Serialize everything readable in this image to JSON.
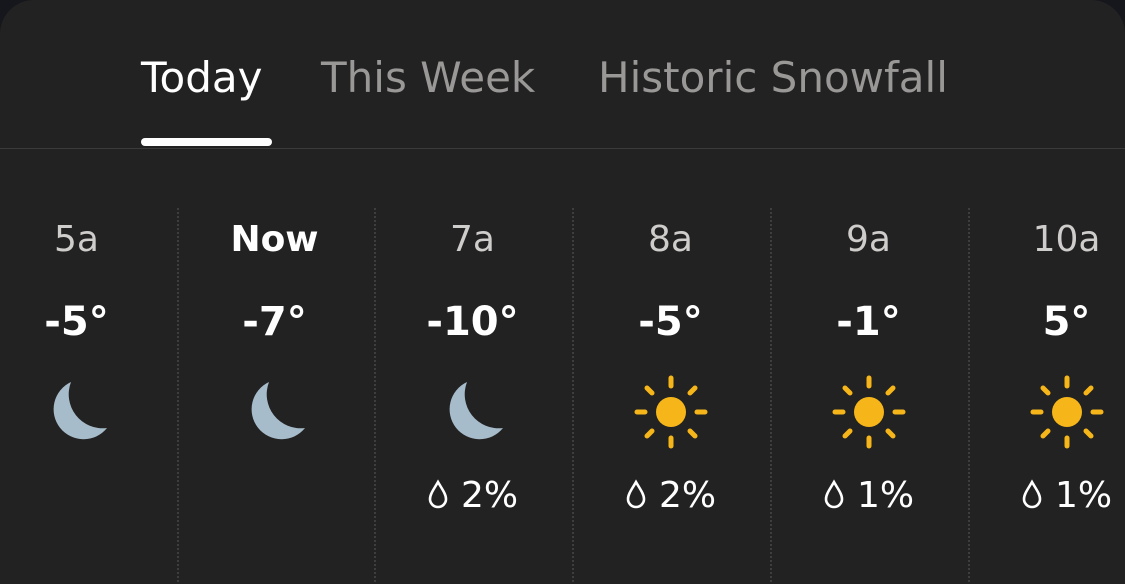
{
  "tabs": [
    {
      "label": "Today",
      "active": true
    },
    {
      "label": "This Week",
      "active": false
    },
    {
      "label": "Historic Snowfall",
      "active": false
    }
  ],
  "hours": [
    {
      "time": "5a",
      "temp": "-5°",
      "icon": "moon-icon",
      "precip": ""
    },
    {
      "time": "Now",
      "temp": "-7°",
      "icon": "moon-icon",
      "precip": ""
    },
    {
      "time": "7a",
      "temp": "-10°",
      "icon": "moon-icon",
      "precip": "2%"
    },
    {
      "time": "8a",
      "temp": "-5°",
      "icon": "sun-icon",
      "precip": "2%"
    },
    {
      "time": "9a",
      "temp": "-1°",
      "icon": "sun-icon",
      "precip": "1%"
    },
    {
      "time": "10a",
      "temp": "5°",
      "icon": "sun-icon",
      "precip": "1%"
    }
  ],
  "colors": {
    "background": "#232222",
    "moon": "#a7bccb",
    "sun": "#f6b619",
    "text_primary": "#ffffff",
    "text_secondary": "#9a9897"
  }
}
